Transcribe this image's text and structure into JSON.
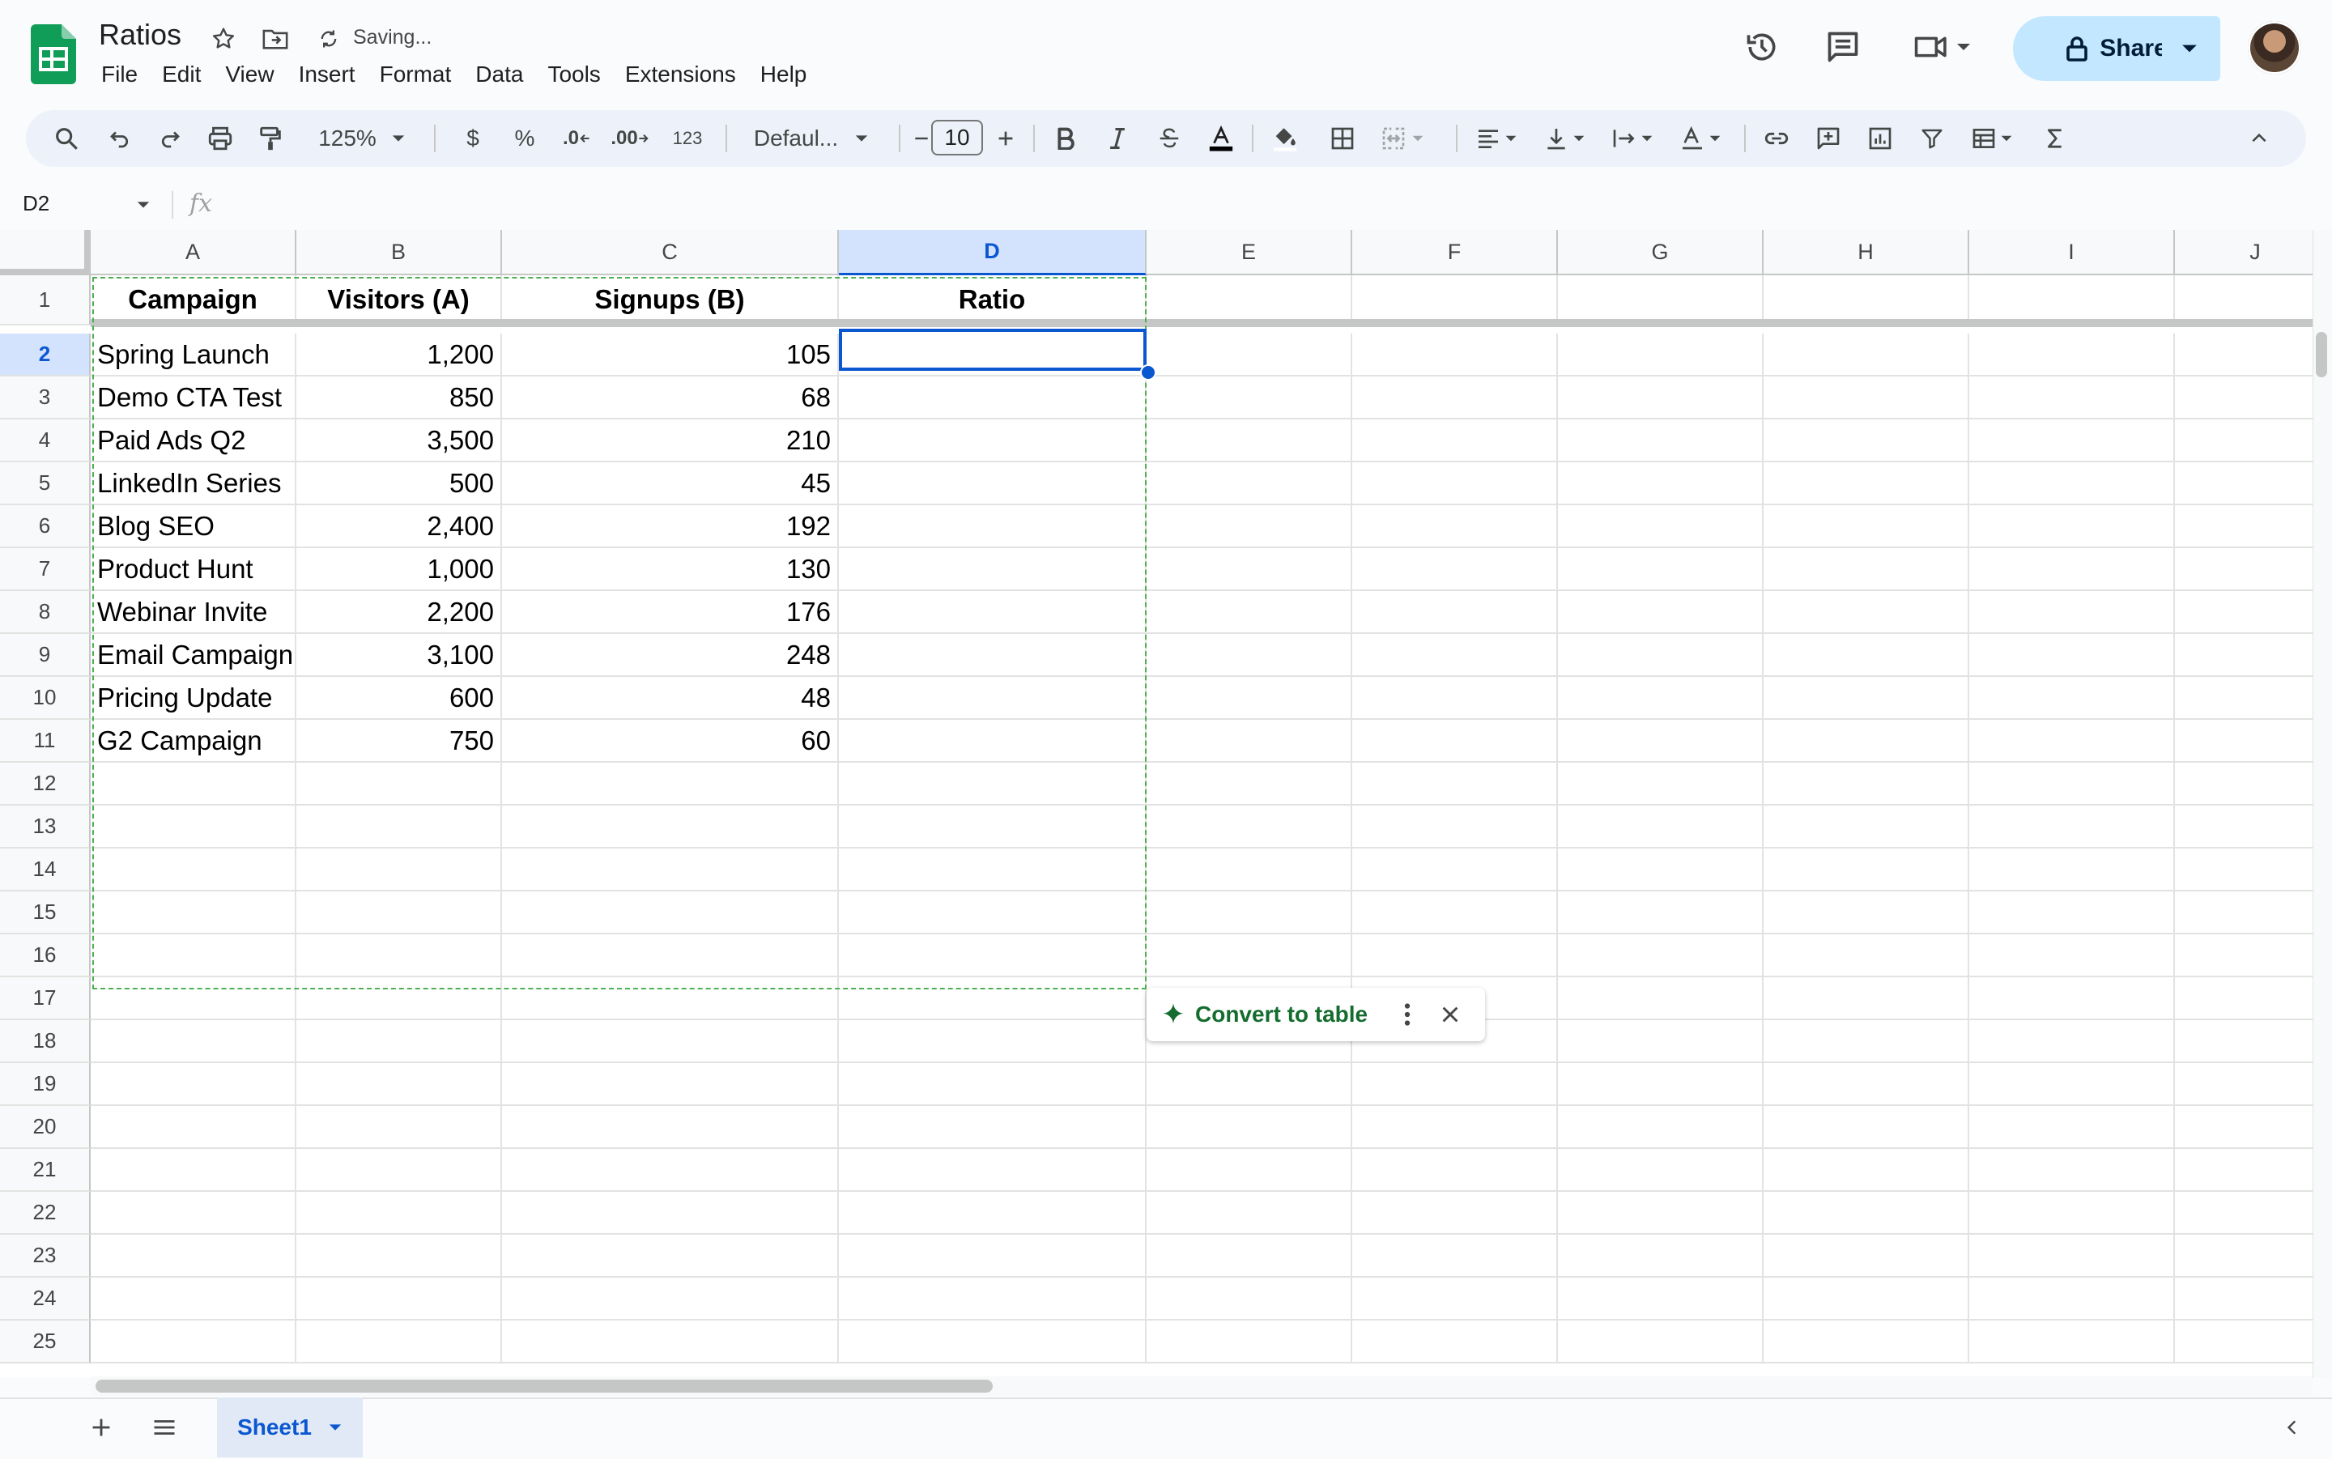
{
  "doc": {
    "title": "Ratios",
    "status": "Saving...",
    "menu": [
      "File",
      "Edit",
      "View",
      "Insert",
      "Format",
      "Data",
      "Tools",
      "Extensions",
      "Help"
    ],
    "share_label": "Share"
  },
  "toolbar": {
    "zoom": "125%",
    "currency": "$",
    "percent": "%",
    "dec_decrease": ".0",
    "dec_increase": ".00",
    "number_format": "123",
    "font": "Defaul...",
    "font_size": "10"
  },
  "formula_bar": {
    "name_box": "D2",
    "fx": "fx",
    "value": ""
  },
  "sheet": {
    "columns": [
      "A",
      "B",
      "C",
      "D",
      "E",
      "F",
      "G",
      "H",
      "I",
      "J"
    ],
    "selected_column": "D",
    "selected_row": 2,
    "row_numbers": [
      "1",
      "2",
      "3",
      "4",
      "5",
      "6",
      "7",
      "8",
      "9",
      "10",
      "11",
      "12",
      "13",
      "14",
      "15",
      "16",
      "17",
      "18",
      "19",
      "20",
      "21",
      "22",
      "23",
      "24",
      "25"
    ],
    "header": [
      "Campaign",
      "Visitors (A)",
      "Signups (B)",
      "Ratio"
    ],
    "rows": [
      [
        "Spring Launch",
        "1,200",
        "105",
        ""
      ],
      [
        "Demo CTA Test",
        "850",
        "68",
        ""
      ],
      [
        "Paid Ads Q2",
        "3,500",
        "210",
        ""
      ],
      [
        "LinkedIn Series",
        "500",
        "45",
        ""
      ],
      [
        "Blog SEO",
        "2,400",
        "192",
        ""
      ],
      [
        "Product Hunt",
        "1,000",
        "130",
        ""
      ],
      [
        "Webinar Invite",
        "2,200",
        "176",
        ""
      ],
      [
        "Email Campaign",
        "3,100",
        "248",
        ""
      ],
      [
        "Pricing Update",
        "600",
        "48",
        ""
      ],
      [
        "G2 Campaign",
        "750",
        "60",
        ""
      ]
    ]
  },
  "convert_chip": {
    "label": "Convert to table"
  },
  "tabs": {
    "active": "Sheet1"
  },
  "colors": {
    "accent": "#0b57d0",
    "share_bg": "#c2e7ff",
    "chip_green": "#146c2e",
    "logo_green": "#0f9d58"
  }
}
